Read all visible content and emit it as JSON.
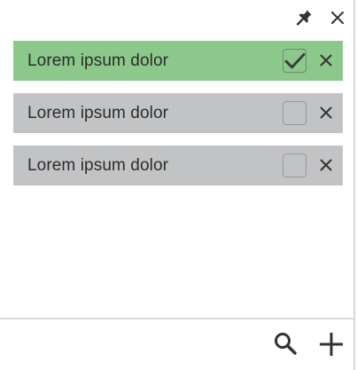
{
  "toolbar": {
    "pin_icon": "pin-icon",
    "close_icon": "close-icon"
  },
  "todos": [
    {
      "label": "Lorem ipsum dolor",
      "checked": true,
      "status_color": "#8cc88c"
    },
    {
      "label": "Lorem ipsum dolor",
      "checked": false,
      "status_color": "#c2c3c5"
    },
    {
      "label": "Lorem ipsum dolor",
      "checked": false,
      "status_color": "#c2c3c5"
    }
  ],
  "footer": {
    "search_icon": "search-icon",
    "add_icon": "plus-icon"
  },
  "colors": {
    "done": "#8cc88c",
    "pending": "#c2c3c5",
    "icon": "#333333"
  }
}
